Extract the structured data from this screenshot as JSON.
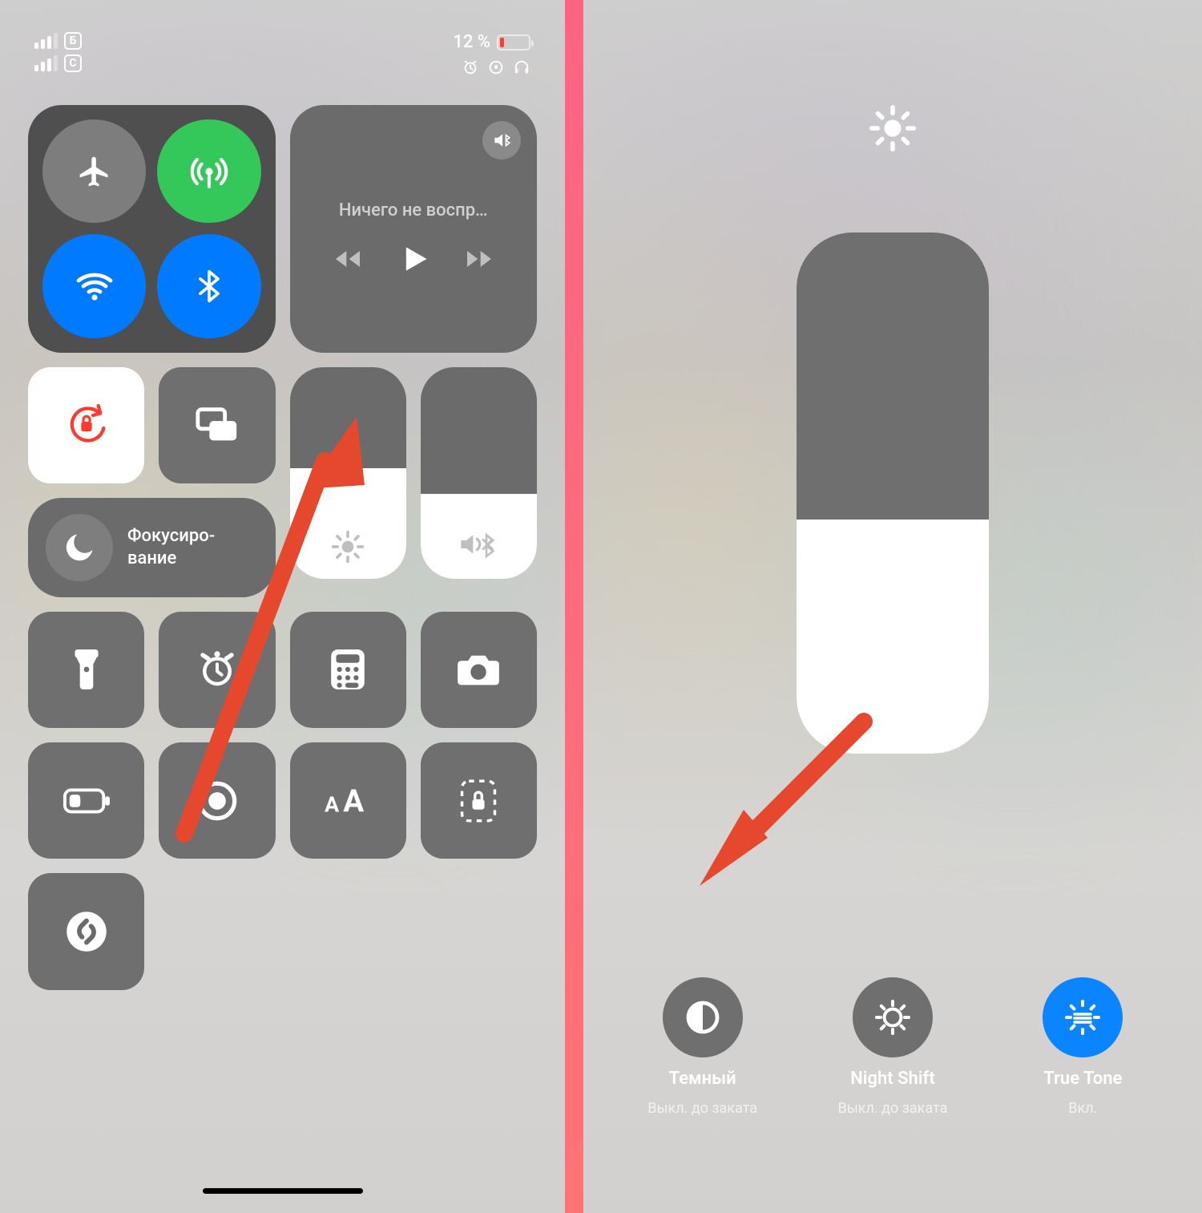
{
  "status": {
    "sim1_label": "Б",
    "sim2_label": "С",
    "battery_percent_text": "12 %",
    "battery_level": 12
  },
  "connectivity": {
    "airplane": "off",
    "cellular": "on",
    "wifi": "on",
    "bluetooth": "on"
  },
  "media": {
    "now_playing_text": "Ничего не воспр…"
  },
  "focus": {
    "label": "Фокусиро­вание"
  },
  "sliders": {
    "brightness_level_percent": 52,
    "volume_level_percent": 40,
    "expanded_brightness_percent": 45
  },
  "tiles": {
    "orientation_lock": "on",
    "screen_mirroring": "off",
    "flashlight": "off",
    "timer": "off",
    "calculator": "off",
    "camera": "off",
    "low_power": "off",
    "screen_record": "off",
    "text_size": "off",
    "guided_access": "off",
    "shazam": "off"
  },
  "brightness_options": [
    {
      "id": "dark-mode",
      "title": "Темный",
      "subtitle": "Выкл. до заката",
      "active": false
    },
    {
      "id": "night-shift",
      "title": "Night Shift",
      "subtitle": "Выкл. до заката",
      "active": false
    },
    {
      "id": "true-tone",
      "title": "True Tone",
      "subtitle": "Вкл.",
      "active": true
    }
  ],
  "annotations": {
    "arrow_1_target": "brightness-slider",
    "arrow_2_target": "dark-mode-option"
  }
}
